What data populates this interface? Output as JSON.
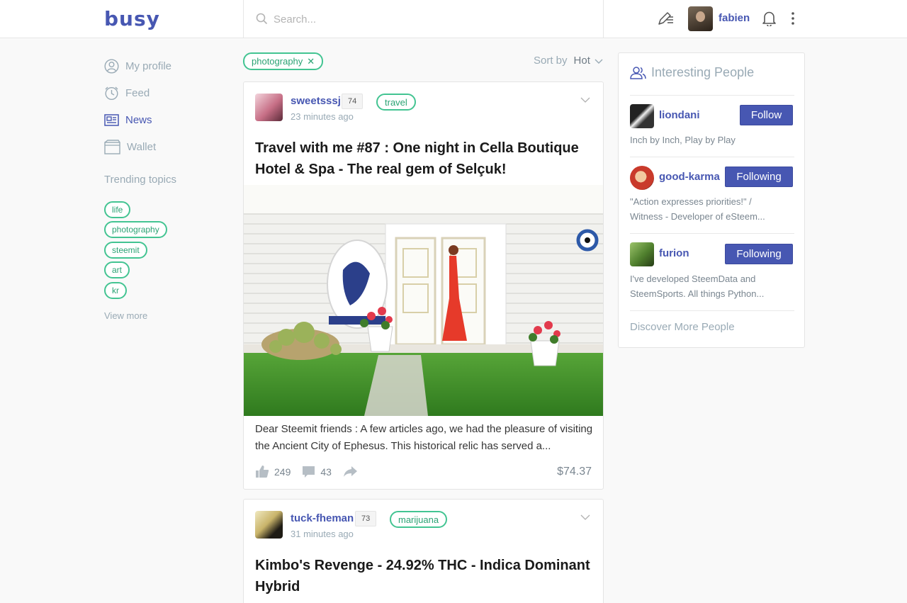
{
  "header": {
    "logo": "busy",
    "search_placeholder": "Search...",
    "username": "fabien",
    "icons": [
      "search-icon",
      "compose-icon",
      "bell-icon",
      "more-vertical-icon"
    ]
  },
  "left_nav": {
    "items": [
      {
        "label": "My profile",
        "icon": "user-circle-icon"
      },
      {
        "label": "Feed",
        "icon": "clock-icon"
      },
      {
        "label": "News",
        "icon": "newspaper-icon"
      },
      {
        "label": "Wallet",
        "icon": "wallet-icon"
      }
    ],
    "trending_title": "Trending topics",
    "topics": [
      "life",
      "photography",
      "steemit",
      "art",
      "kr"
    ],
    "view_more": "View more"
  },
  "feed": {
    "active_filter": "photography",
    "sort_label": "Sort by",
    "sort_value": "Hot",
    "posts": [
      {
        "author": "sweetsssj",
        "reputation": "74",
        "tag": "travel",
        "time": "23 minutes ago",
        "title": "Travel with me #87 : One night in Cella Boutique Hotel & Spa - The real gem of Selçuk!",
        "excerpt": "Dear Steemit friends : A few articles ago, we had the pleasure of visiting the Ancient City of Ephesus. This historical relic has served a...",
        "votes": "249",
        "comments": "43",
        "payout": "$74.37"
      },
      {
        "author": "tuck-fheman",
        "reputation": "73",
        "tag": "marijuana",
        "time": "31 minutes ago",
        "title": "Kimbo's Revenge - 24.92% THC - Indica Dominant Hybrid"
      }
    ]
  },
  "sidebar": {
    "title": "Interesting People",
    "people": [
      {
        "name": "liondani",
        "button": "Follow",
        "desc": "Inch by Inch, Play by Play"
      },
      {
        "name": "good-karma",
        "button": "Following",
        "desc": "\"Action expresses priorities!\" / Witness - Developer of eSteem..."
      },
      {
        "name": "furion",
        "button": "Following",
        "desc": "I've developed SteemData and SteemSports. All things Python..."
      }
    ],
    "discover": "Discover More People"
  },
  "colors": {
    "brand": "#4757b2",
    "tag_green": "#43c492",
    "muted": "#99aab5"
  }
}
